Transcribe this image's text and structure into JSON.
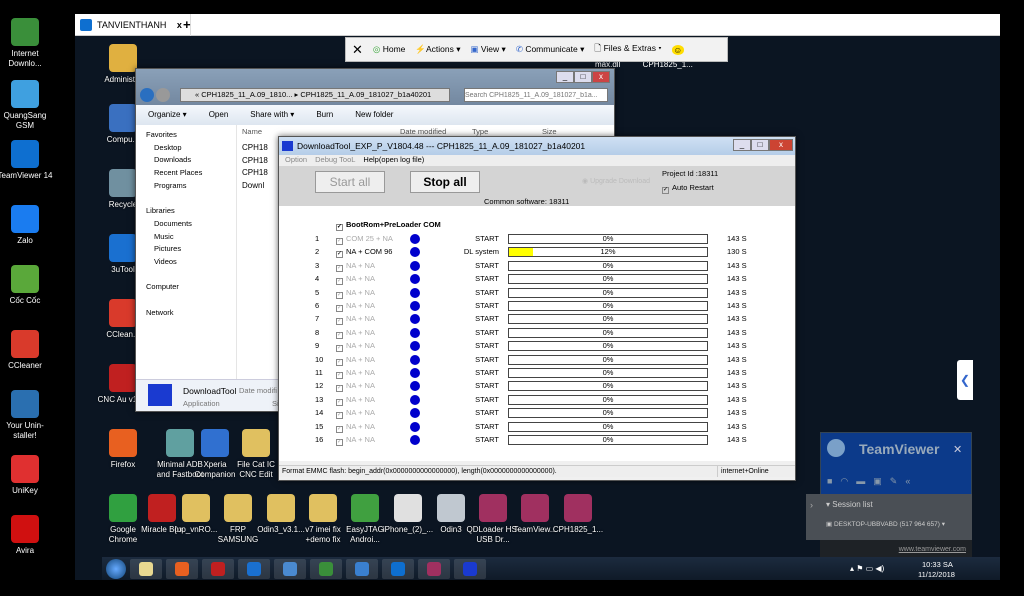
{
  "local_desktop": {
    "icons": [
      {
        "label": "Internet Downlo...",
        "color": "#3a8f3a"
      },
      {
        "label": "QuangSang GSM",
        "color": "#3fa0e0"
      },
      {
        "label": "TeamViewer 14",
        "color": "#0e6fd0"
      },
      {
        "label": "Zalo",
        "color": "#1a7cf0"
      },
      {
        "label": "Cốc Cốc",
        "color": "#5aa83a"
      },
      {
        "label": "CCleaner",
        "color": "#d93a2b"
      },
      {
        "label": "Your Unin-staller!",
        "color": "#2a6fb0"
      },
      {
        "label": "UniKey",
        "color": "#e03030"
      },
      {
        "label": "Avira",
        "color": "#d01010"
      }
    ]
  },
  "teamviewer": {
    "tab_label": "TANVIENTHANH",
    "tab_close": "x",
    "new_tab": "+",
    "toolbar": {
      "close": "✕",
      "home": "Home",
      "actions": "Actions ▾",
      "view": "View ▾",
      "communicate": "Communicate ▾",
      "files": "Files & Extras ▾",
      "emoji": "☺"
    },
    "panel": {
      "brand": "TeamViewer",
      "close": "✕",
      "session_list": "Session list",
      "session": "DESKTOP-UBBVABD (517 964 657)",
      "link": "www.teamviewer.com"
    }
  },
  "remote_desktop": {
    "left_icons": [
      {
        "label": "Administ...",
        "color": "#e0b040"
      },
      {
        "label": "Compu...",
        "color": "#3a70c0"
      },
      {
        "label": "Recycle",
        "color": "#7090a0"
      },
      {
        "label": "3uTool",
        "color": "#1a70d0"
      },
      {
        "label": "CClean...",
        "color": "#d93a2b"
      },
      {
        "label": "CNC Au v1.02",
        "color": "#c02020"
      },
      {
        "label": "Firefox",
        "color": "#e86020"
      },
      {
        "label": "Google Chrome",
        "color": "#30a040"
      }
    ],
    "bottom_icons": [
      {
        "label": "Minimal ADB and Fastboot",
        "color": "#60a0a0"
      },
      {
        "label": "Xperia Companion",
        "color": "#3070d0"
      },
      {
        "label": "File Cat IC CNC Edit",
        "color": "#e0c060"
      },
      {
        "label": "Miracle Box",
        "color": "#c02020"
      },
      {
        "label": "[up_vnRO...",
        "color": "#e0c060"
      },
      {
        "label": "FRP SAMSUNG",
        "color": "#e0c060"
      },
      {
        "label": "Odin3_v3.1...",
        "color": "#e0c060"
      },
      {
        "label": "v7 imei fix +demo fix",
        "color": "#e0c060"
      },
      {
        "label": "EasyJTAG Androi...",
        "color": "#40a040"
      },
      {
        "label": "iPhone_(2)_...",
        "color": "#e0e0e0"
      },
      {
        "label": "Odin3",
        "color": "#c0c8d0"
      },
      {
        "label": "QDLoader HS-USB Dr...",
        "color": "#a03060"
      },
      {
        "label": "TeamView...",
        "color": "#a03060"
      },
      {
        "label": "CPH1825_1...",
        "color": "#a03060"
      }
    ],
    "top_right_labels": [
      "max.dll",
      "CPH1825_1..."
    ],
    "clock": {
      "time": "10:33 SA",
      "date": "11/12/2018"
    }
  },
  "explorer": {
    "path_prev": "« CPH1825_11_A.09_1810...",
    "path": "CPH1825_11_A.09_181027_b1a40201",
    "search_placeholder": "Search CPH1825_11_A.09_181027_b1a...",
    "toolbar": [
      "Organize ▾",
      "Open",
      "Share with ▾",
      "Burn",
      "New folder"
    ],
    "columns": [
      "Name",
      "Date modified",
      "Type",
      "Size"
    ],
    "files": [
      "CPH18",
      "CPH18",
      "CPH18",
      "Downl"
    ],
    "nav": [
      "Favorites",
      "Desktop",
      "Downloads",
      "Recent Places",
      "Programs",
      "",
      "Libraries",
      "Documents",
      "Music",
      "Pictures",
      "Videos",
      "",
      "Computer",
      "",
      "Network"
    ],
    "details": {
      "name": "DownloadTool",
      "type": "Application",
      "date_label": "Date modifi",
      "size_label": "Si"
    }
  },
  "downloadtool": {
    "title": "DownloadTool_EXP_P_V1804.48 --- CPH1825_11_A.09_181027_b1a40201",
    "menu": [
      "Option",
      "Debug TooL",
      "Help(open log file)"
    ],
    "start_all": "Start all",
    "stop_all": "Stop all",
    "upgrade_download": "Upgrade Download",
    "project_id": "Project Id :18311",
    "auto_restart": "Auto Restart",
    "common_software": "Common software: 18311",
    "bootrom_label": "BootRom+PreLoader COM",
    "accent": "#0000cc",
    "progress_color": "#ffff00",
    "rows": [
      {
        "n": "1",
        "port": "COM 25 + NA",
        "status": "START",
        "percent": "0%",
        "progress": 0,
        "time": "143 S"
      },
      {
        "n": "2",
        "port": "NA + COM 96",
        "status": "DL system",
        "percent": "12%",
        "progress": 12,
        "time": "130 S"
      },
      {
        "n": "3",
        "port": "NA + NA",
        "status": "START",
        "percent": "0%",
        "progress": 0,
        "time": "143 S"
      },
      {
        "n": "4",
        "port": "NA + NA",
        "status": "START",
        "percent": "0%",
        "progress": 0,
        "time": "143 S"
      },
      {
        "n": "5",
        "port": "NA + NA",
        "status": "START",
        "percent": "0%",
        "progress": 0,
        "time": "143 S"
      },
      {
        "n": "6",
        "port": "NA + NA",
        "status": "START",
        "percent": "0%",
        "progress": 0,
        "time": "143 S"
      },
      {
        "n": "7",
        "port": "NA + NA",
        "status": "START",
        "percent": "0%",
        "progress": 0,
        "time": "143 S"
      },
      {
        "n": "8",
        "port": "NA + NA",
        "status": "START",
        "percent": "0%",
        "progress": 0,
        "time": "143 S"
      },
      {
        "n": "9",
        "port": "NA + NA",
        "status": "START",
        "percent": "0%",
        "progress": 0,
        "time": "143 S"
      },
      {
        "n": "10",
        "port": "NA + NA",
        "status": "START",
        "percent": "0%",
        "progress": 0,
        "time": "143 S"
      },
      {
        "n": "11",
        "port": "NA + NA",
        "status": "START",
        "percent": "0%",
        "progress": 0,
        "time": "143 S"
      },
      {
        "n": "12",
        "port": "NA + NA",
        "status": "START",
        "percent": "0%",
        "progress": 0,
        "time": "143 S"
      },
      {
        "n": "13",
        "port": "NA + NA",
        "status": "START",
        "percent": "0%",
        "progress": 0,
        "time": "143 S"
      },
      {
        "n": "14",
        "port": "NA + NA",
        "status": "START",
        "percent": "0%",
        "progress": 0,
        "time": "143 S"
      },
      {
        "n": "15",
        "port": "NA + NA",
        "status": "START",
        "percent": "0%",
        "progress": 0,
        "time": "143 S"
      },
      {
        "n": "16",
        "port": "NA + NA",
        "status": "START",
        "percent": "0%",
        "progress": 0,
        "time": "143 S"
      }
    ],
    "status_msg": "Format EMMC flash:  begin_addr(0x0000000000000000), length(0x0000000000000000).",
    "status_net": "internet+Online"
  }
}
